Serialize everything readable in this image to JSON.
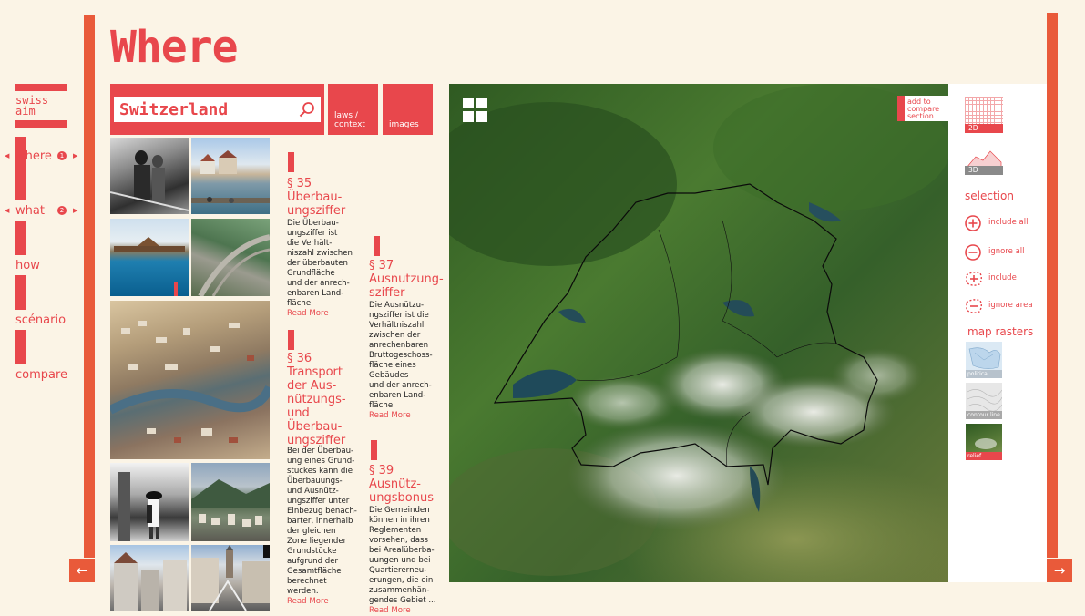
{
  "page_title": "Where",
  "logo": {
    "line1": "swiss",
    "line2": "aim"
  },
  "nav": [
    {
      "label": "where",
      "badge": "1"
    },
    {
      "label": "what",
      "badge": "2"
    },
    {
      "label": "how"
    },
    {
      "label": "scénario"
    },
    {
      "label": "compare"
    }
  ],
  "search": {
    "value": "Switzerland"
  },
  "tabs": {
    "laws_line1": "laws  /",
    "laws_line2": "context",
    "images": "images"
  },
  "articles": [
    {
      "title_lines": [
        "§ 35",
        "Überbau-",
        "ungsziffer"
      ],
      "body_lines": [
        "Die Überbau-",
        "ungsziffer ist",
        "die Verhält-",
        "niszahl zwischen",
        "der überbauten",
        "Grundfläche",
        "und der anrech-",
        "enbaren Land-",
        "fläche."
      ],
      "read_more": "Read More"
    },
    {
      "title_lines": [
        "§ 36",
        "Transport",
        "der Aus-",
        "nützungs-",
        "und",
        "Überbau-",
        "ungsziffer"
      ],
      "body_lines": [
        "Bei der Überbau-",
        "ung eines Grund-",
        "stückes kann die",
        "Überbauungs-",
        "und Ausnütz-",
        "ungsziffer unter",
        "Einbezug benach-",
        "barter, innerhalb",
        "der gleichen",
        "Zone liegender",
        "Grundstücke",
        "aufgrund der",
        "Gesamtfläche",
        "berechnet",
        "werden."
      ],
      "read_more": "Read More"
    },
    {
      "title_lines": [
        "§ 37",
        "Ausnutzung-",
        "sziffer"
      ],
      "body_lines": [
        "Die Ausnützu-",
        "ngsziffer ist die",
        "Verhältniszahl",
        "zwischen der",
        "anrechenbaren",
        "Bruttogeschoss-",
        "fläche eines",
        "Gebäudes",
        "und der anrech-",
        "enbaren Land-",
        "fläche."
      ],
      "read_more": "Read More"
    },
    {
      "title_lines": [
        "§ 39",
        "Ausnütz-",
        "ungsbonus"
      ],
      "body_lines": [
        "Die Gemeinden",
        "können in ihren",
        "Reglementen",
        "vorsehen, dass",
        "bei Arealüberba-",
        "uungen und bei",
        "Quartiererneu-",
        "erungen, die ein",
        "zusammenhän-",
        "gendes Gebiet ..."
      ],
      "read_more": "Read More"
    }
  ],
  "map": {
    "add_compare_line1": "add to",
    "add_compare_line2": "compare",
    "add_compare_line3": "section"
  },
  "view_modes": [
    "2D",
    "3D"
  ],
  "selection": {
    "heading": "selection",
    "items": [
      "include all",
      "ignore all",
      "include",
      "ignore area"
    ]
  },
  "rasters": {
    "heading": "map rasters",
    "items": [
      "political",
      "contour line",
      "relief"
    ]
  },
  "colors": {
    "accent": "#e8474c",
    "frame": "#e95a3a",
    "background": "#fbf4e6"
  }
}
